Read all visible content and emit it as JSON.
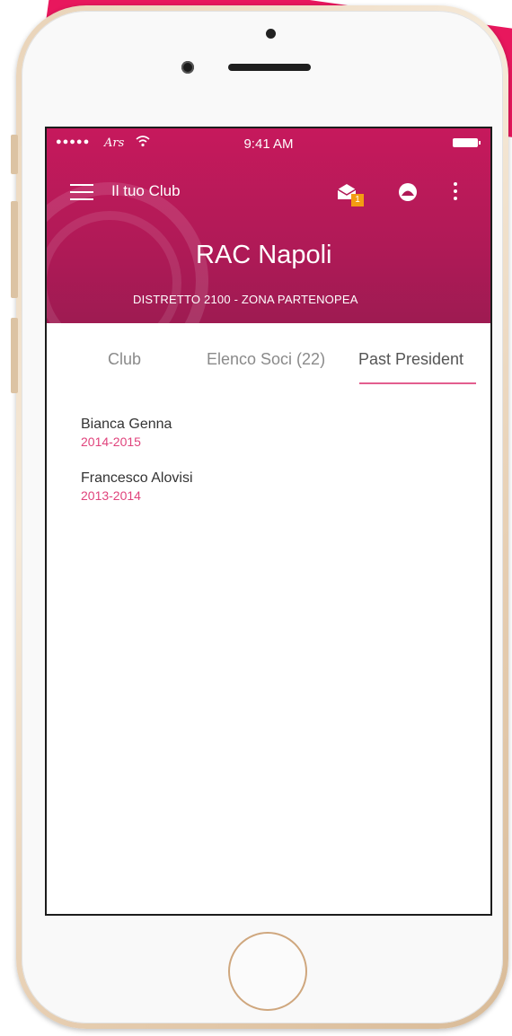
{
  "status_bar": {
    "signal": "●●●●●",
    "carrier": "Ars",
    "time": "9:41 AM"
  },
  "toolbar": {
    "title": "Il tuo Club",
    "badge_count": "1",
    "icons": [
      "menu-icon",
      "mail-icon",
      "profile-icon",
      "more-vert-icon"
    ]
  },
  "club": {
    "name": "RAC Napoli",
    "subtitle": "DISTRETTO 2100 - ZONA PARTENOPEA"
  },
  "tabs": [
    {
      "label": "Club",
      "active": false
    },
    {
      "label": "Elenco Soci (22)",
      "active": false
    },
    {
      "label": "Past President",
      "active": true
    }
  ],
  "past_presidents": [
    {
      "name": "Bianca Genna",
      "years": "2014-2015"
    },
    {
      "name": "Francesco Alovisi",
      "years": "2013-2014"
    }
  ],
  "colors": {
    "primary": "#b01a57",
    "accent": "#e0437c",
    "badge": "#f39c12",
    "backdrop": "#e8175d"
  }
}
